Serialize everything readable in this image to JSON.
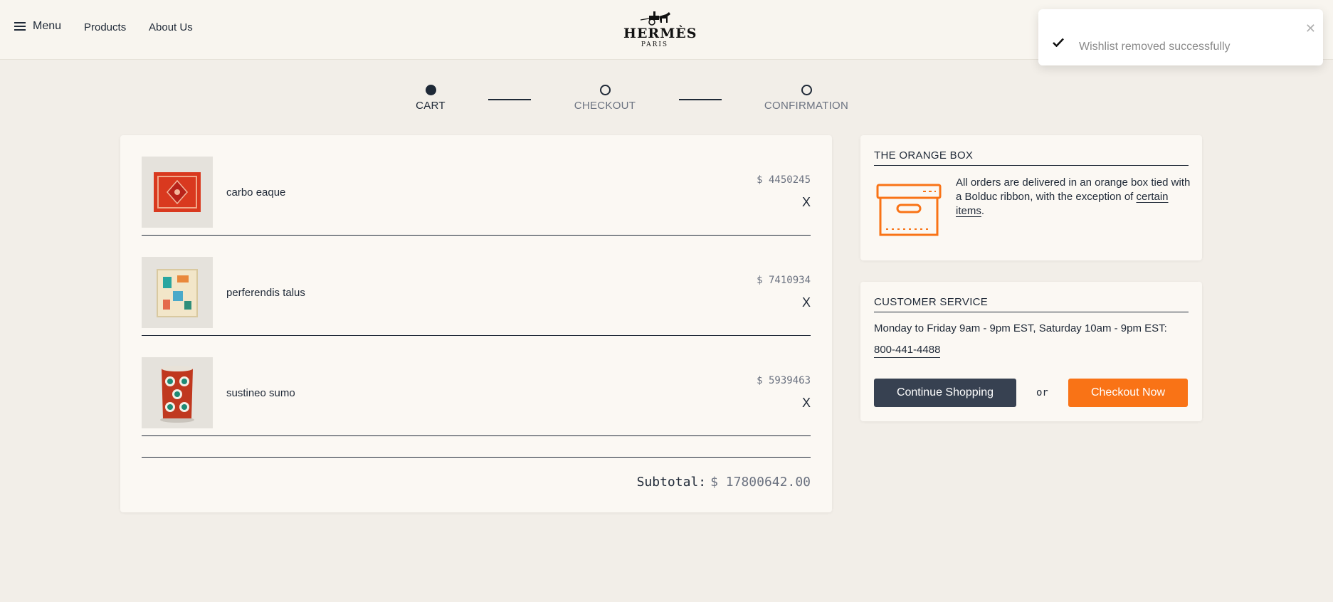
{
  "header": {
    "menu_label": "Menu",
    "nav": [
      "Products",
      "About Us"
    ],
    "logo_word": "HERMÈS",
    "logo_sub": "PARIS"
  },
  "toast": {
    "message": "Wishlist removed successfully",
    "close": "✕"
  },
  "steps": [
    {
      "label": "CART",
      "active": true
    },
    {
      "label": "CHECKOUT",
      "active": false
    },
    {
      "label": "CONFIRMATION",
      "active": false
    }
  ],
  "cart": {
    "items": [
      {
        "name": "carbo eaque",
        "price": "$ 4450245",
        "remove": "X"
      },
      {
        "name": "perferendis talus",
        "price": "$ 7410934",
        "remove": "X"
      },
      {
        "name": "sustineo sumo",
        "price": "$ 5939463",
        "remove": "X"
      }
    ],
    "subtotal_label": "Subtotal:",
    "subtotal_value": "$ 17800642.00"
  },
  "orange_box": {
    "title": "THE ORANGE BOX",
    "text": "All orders are delivered in an orange box tied with a Bolduc ribbon, with the exception of",
    "link": "certain items",
    "after": "."
  },
  "customer_service": {
    "title": "CUSTOMER SERVICE",
    "hours": "Monday to Friday 9am - 9pm EST, Saturday 10am - 9pm EST:",
    "phone": "800-441-4488",
    "continue_label": "Continue Shopping",
    "or": "or",
    "checkout_label": "Checkout Now"
  },
  "colors": {
    "accent": "#f97316",
    "dark": "#374151",
    "background": "#f2eee8"
  }
}
